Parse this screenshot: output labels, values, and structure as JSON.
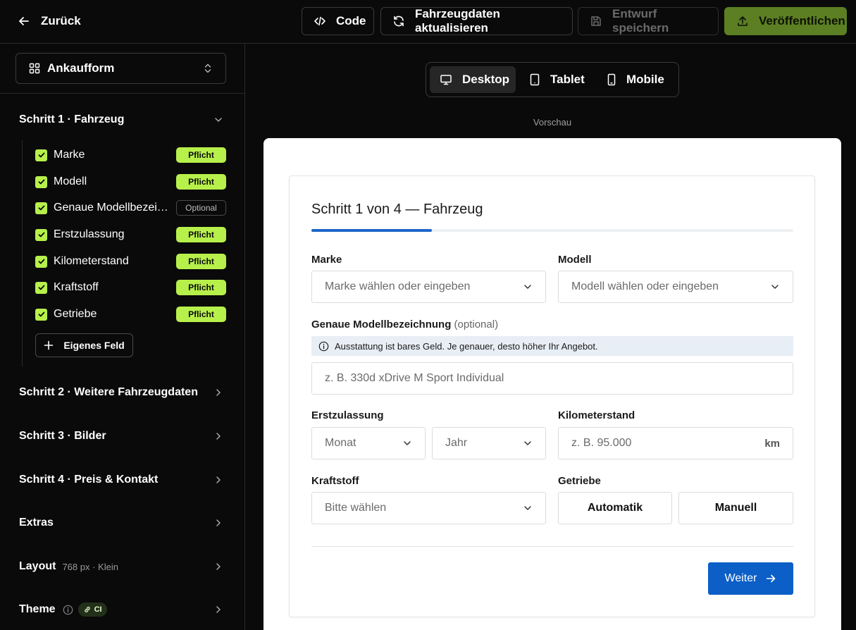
{
  "topbar": {
    "back_label": "Zurück",
    "code_label": "Code",
    "refresh_label": "Fahrzeugdaten aktualisieren",
    "save_draft_label": "Entwurf speichern",
    "publish_label": "Veröffentlichen"
  },
  "sidebar": {
    "form_select_value": "Ankaufform",
    "steps": [
      {
        "label": "Schritt 1 · Fahrzeug",
        "expanded": true
      },
      {
        "label": "Schritt 2 · Weitere Fahrzeugdaten",
        "expanded": false
      },
      {
        "label": "Schritt 3 · Bilder",
        "expanded": false
      },
      {
        "label": "Schritt 4 · Preis & Kontakt",
        "expanded": false
      }
    ],
    "fields": [
      {
        "label": "Marke",
        "badge": "Pflicht",
        "checked": true
      },
      {
        "label": "Modell",
        "badge": "Pflicht",
        "checked": true
      },
      {
        "label": "Genaue Modellbezeichnung",
        "badge": "Optional",
        "checked": true
      },
      {
        "label": "Erstzulassung",
        "badge": "Pflicht",
        "checked": true
      },
      {
        "label": "Kilometerstand",
        "badge": "Pflicht",
        "checked": true
      },
      {
        "label": "Kraftstoff",
        "badge": "Pflicht",
        "checked": true
      },
      {
        "label": "Getriebe",
        "badge": "Pflicht",
        "checked": true
      }
    ],
    "add_field_label": "Eigenes Feld",
    "extras_label": "Extras",
    "layout_label": "Layout",
    "layout_sub": "768 px · Klein",
    "theme_label": "Theme",
    "theme_chip": "CI"
  },
  "devices": {
    "desktop": "Desktop",
    "tablet": "Tablet",
    "mobile": "Mobile",
    "active": "Desktop"
  },
  "preview_label": "Vorschau",
  "form": {
    "title": "Schritt 1 von 4 — Fahrzeug",
    "progress_fraction": 0.25,
    "marke": {
      "label": "Marke",
      "placeholder": "Marke wählen oder eingeben"
    },
    "modell": {
      "label": "Modell",
      "placeholder": "Modell wählen oder eingeben"
    },
    "modellbezeichnung": {
      "label": "Genaue Modellbezeichnung",
      "optional_tag": "(optional)",
      "hint": "Ausstattung ist bares Geld. Je genauer, desto höher Ihr Angebot.",
      "placeholder": "z. B. 330d xDrive M Sport Individual"
    },
    "erstzulassung": {
      "label": "Erstzulassung",
      "month_placeholder": "Monat",
      "year_placeholder": "Jahr"
    },
    "kilometerstand": {
      "label": "Kilometerstand",
      "placeholder": "z. B. 95.000",
      "unit": "km"
    },
    "kraftstoff": {
      "label": "Kraftstoff",
      "placeholder": "Bitte wählen"
    },
    "getriebe": {
      "label": "Getriebe",
      "options": [
        "Automatik",
        "Manuell"
      ]
    },
    "next_label": "Weiter"
  },
  "colors": {
    "accent_lime": "#b7f04a",
    "publish_green": "#5c7f23",
    "primary_blue": "#0b5fc7",
    "progress_blue": "#1f66c9"
  }
}
